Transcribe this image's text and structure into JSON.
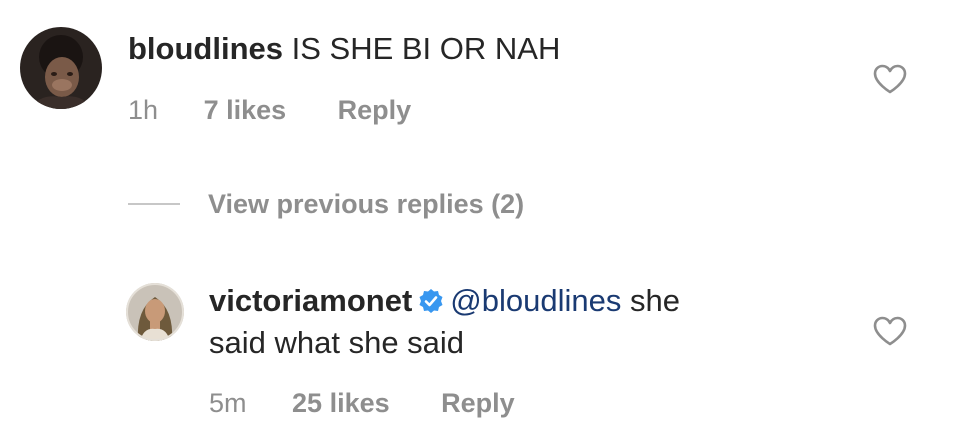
{
  "comments": [
    {
      "username": "bloudlines",
      "text": "IS SHE BI OR NAH",
      "time": "1h",
      "likes": "7 likes",
      "reply_label": "Reply",
      "avatar_icon": "profile-photo"
    },
    {
      "username": "victoriamonet",
      "verified": true,
      "mention": "@bloudlines",
      "text_line1": "she",
      "text_line2": "said what she said",
      "time": "5m",
      "likes": "25 likes",
      "reply_label": "Reply",
      "avatar_icon": "profile-photo"
    }
  ],
  "view_previous_replies": "View previous replies (2)",
  "icons": {
    "like": "heart-outline-icon",
    "verified": "verified-badge-icon"
  },
  "colors": {
    "text": "#262626",
    "secondary": "#8e8e8e",
    "mention": "#1a3a72",
    "verified": "#3897f0"
  }
}
